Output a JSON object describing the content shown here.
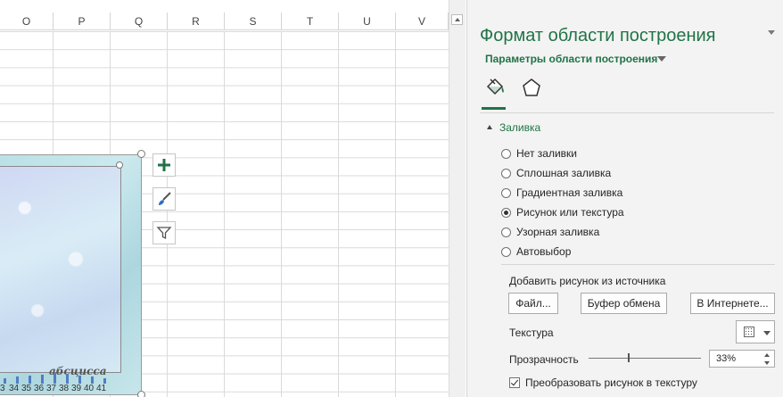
{
  "columns": [
    "O",
    "P",
    "Q",
    "R",
    "S",
    "T",
    "U",
    "V"
  ],
  "chart": {
    "axis_title": "абсцисса",
    "axis_ticks": [
      "3",
      "34",
      "35",
      "36",
      "37",
      "38",
      "39",
      "40",
      "41"
    ]
  },
  "chart_buttons": {
    "add_icon": "plus-icon",
    "style_icon": "brush-icon",
    "filter_icon": "funnel-icon"
  },
  "pane": {
    "title": "Формат области построения",
    "subtitle": "Параметры области построения",
    "tabs": [
      {
        "icon": "paint-bucket-icon",
        "active": true
      },
      {
        "icon": "pentagon-icon",
        "active": false
      }
    ],
    "section": "Заливка",
    "fill_options": [
      {
        "label": "Нет заливки",
        "checked": false
      },
      {
        "label": "Сплошная заливка",
        "checked": false
      },
      {
        "label": "Градиентная заливка",
        "checked": false
      },
      {
        "label": "Рисунок или текстура",
        "checked": true
      },
      {
        "label": "Узорная заливка",
        "checked": false
      },
      {
        "label": "Автовыбор",
        "checked": false
      }
    ],
    "insert_from": "Добавить рисунок из источника",
    "buttons": {
      "file": "Файл...",
      "clipboard": "Буфер обмена",
      "online": "В Интернете..."
    },
    "texture_label": "Текстура",
    "transparency_label": "Прозрачность",
    "transparency_value": "33%",
    "tile_checkbox": "Преобразовать рисунок в текстуру",
    "tile_checked": true
  },
  "colors": {
    "accent": "#217346",
    "pane_bg": "#f3f3f3",
    "grid_line": "#dadada",
    "bar": "#4f7ec2"
  }
}
